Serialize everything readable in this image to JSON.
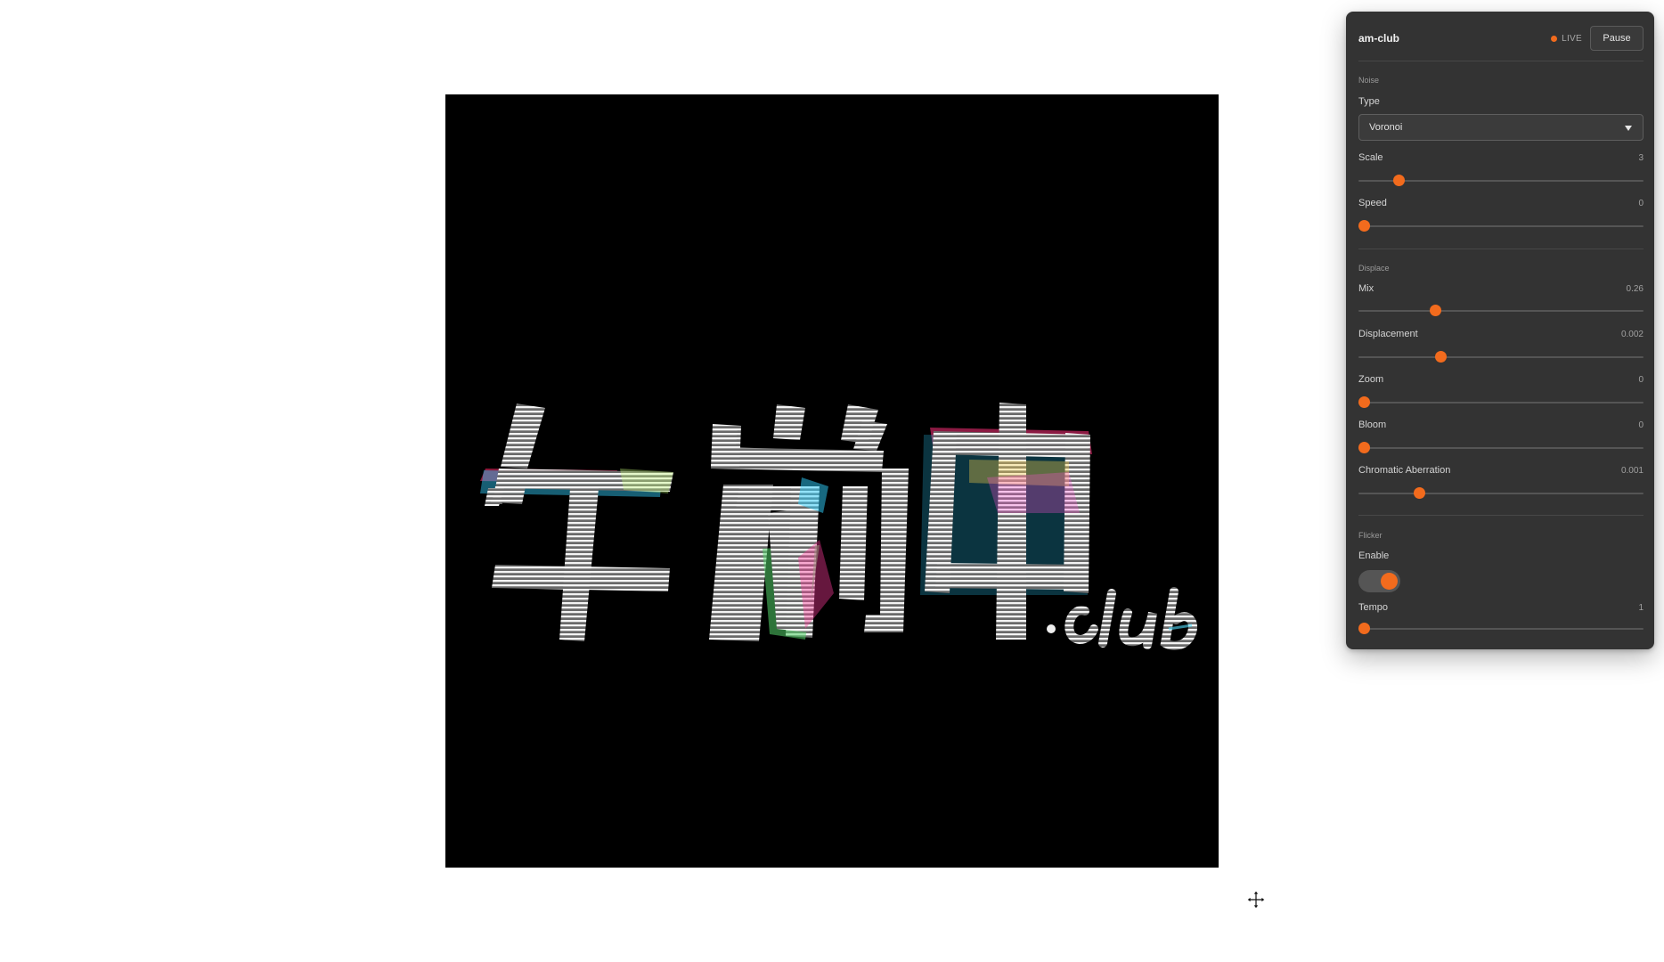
{
  "logo": {
    "text": "午前中.club"
  },
  "panel": {
    "title": "am-club",
    "live_label": "LIVE",
    "pause_label": "Pause",
    "colors": {
      "accent": "#f26b1d",
      "panel_bg": "#333333"
    },
    "noise": {
      "section_label": "Noise",
      "type_label": "Type",
      "type_value": "Voronoi",
      "scale": {
        "label": "Scale",
        "value": "3",
        "fraction": 0.125
      },
      "speed": {
        "label": "Speed",
        "value": "0",
        "fraction": 0.0
      }
    },
    "displace": {
      "section_label": "Displace",
      "mix": {
        "label": "Mix",
        "value": "0.26",
        "fraction": 0.26
      },
      "displacement": {
        "label": "Displacement",
        "value": "0.002",
        "fraction": 0.28
      },
      "zoom": {
        "label": "Zoom",
        "value": "0",
        "fraction": 0.0
      },
      "bloom": {
        "label": "Bloom",
        "value": "0",
        "fraction": 0.0
      },
      "chromatic_aberration": {
        "label": "Chromatic Aberration",
        "value": "0.001",
        "fraction": 0.2
      }
    },
    "flicker": {
      "section_label": "Flicker",
      "enable_label": "Enable",
      "enabled": true,
      "tempo": {
        "label": "Tempo",
        "value": "1",
        "fraction": 0.0
      }
    }
  },
  "icons": {
    "cursor": "move-cursor-icon",
    "dropdown": "chevron-down-icon"
  }
}
